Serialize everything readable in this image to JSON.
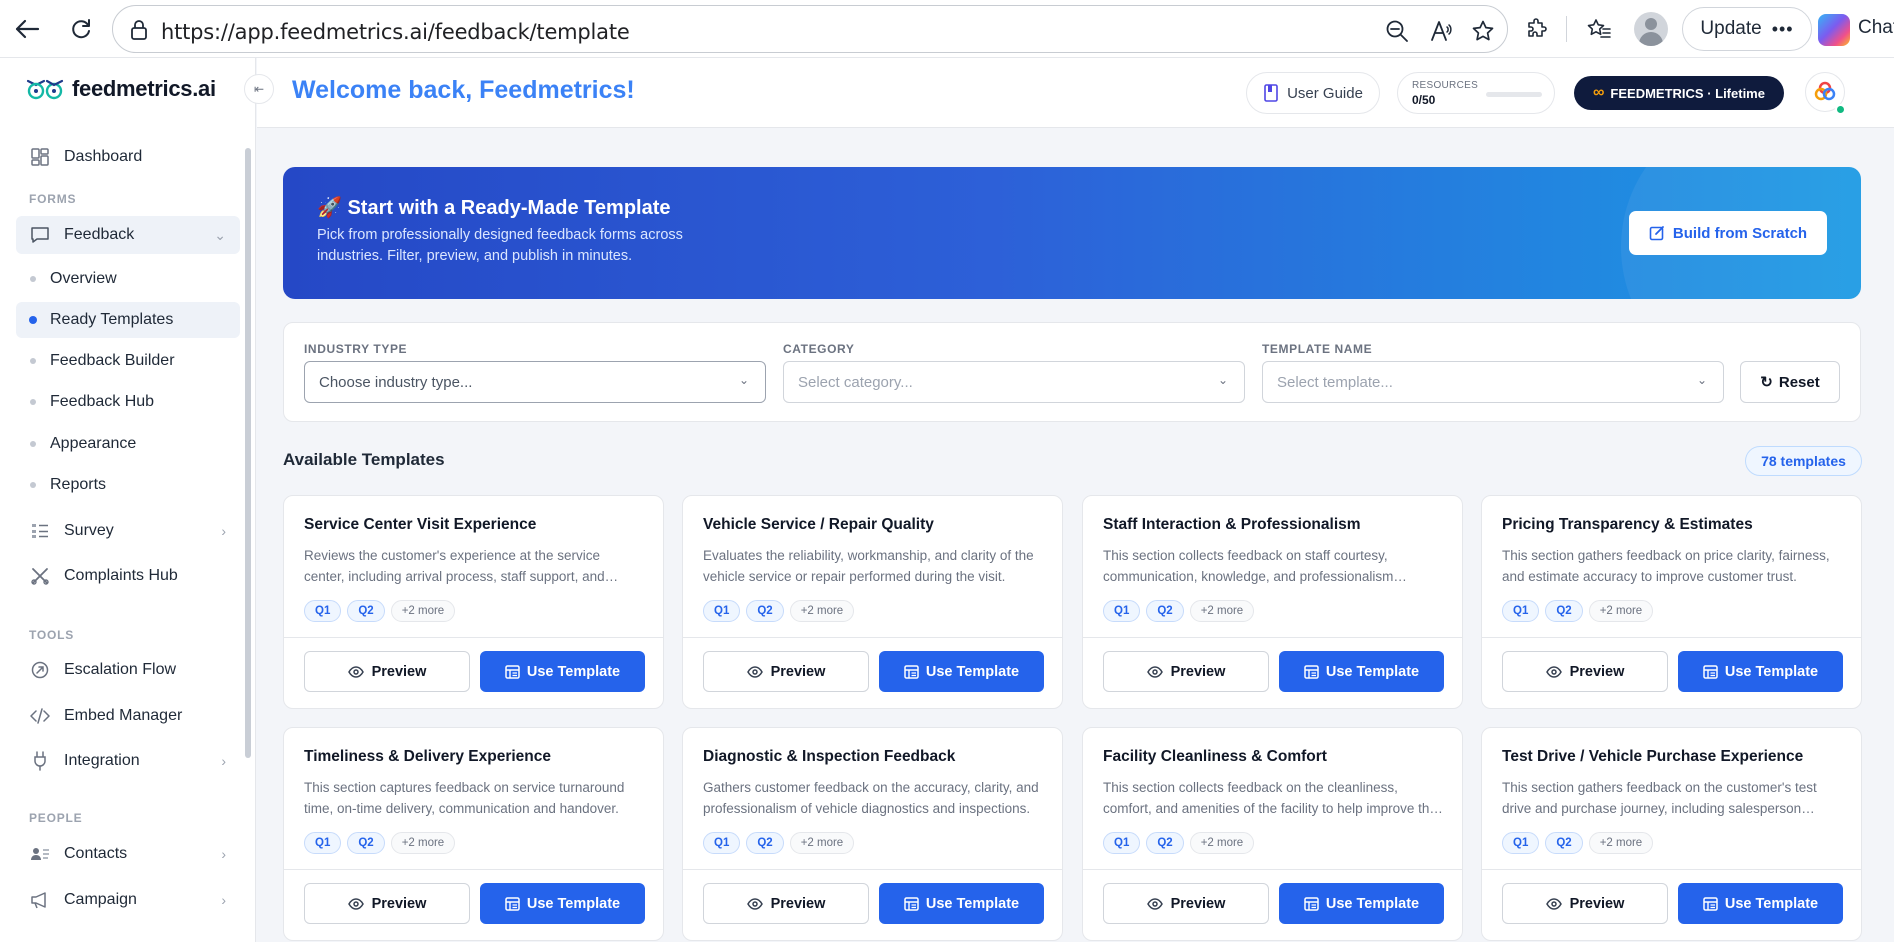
{
  "browser": {
    "url": "https://app.feedmetrics.ai/feedback/template",
    "update_label": "Update",
    "chat_label": "Chat"
  },
  "sidebar": {
    "logo_text": "feedmetrics.ai",
    "dashboard": "Dashboard",
    "forms_label": "FORMS",
    "feedback": "Feedback",
    "sub_items": [
      "Overview",
      "Ready Templates",
      "Feedback Builder",
      "Feedback Hub",
      "Appearance",
      "Reports"
    ],
    "survey": "Survey",
    "complaints": "Complaints Hub",
    "tools_label": "TOOLS",
    "escalation": "Escalation Flow",
    "embed": "Embed Manager",
    "integration": "Integration",
    "people_label": "PEOPLE",
    "contacts": "Contacts",
    "campaign": "Campaign"
  },
  "header": {
    "welcome": "Welcome back, Feedmetrics!",
    "user_guide": "User Guide",
    "resources_label": "RESOURCES",
    "resources_value": "0/50",
    "resources_fraction": 0,
    "plan": "FEEDMETRICS · Lifetime"
  },
  "hero": {
    "title": "🚀 Start with a Ready-Made Template",
    "description": "Pick from professionally designed feedback forms across industries. Filter, preview, and publish in minutes.",
    "build_label": "Build from Scratch"
  },
  "filters": {
    "industry_label": "INDUSTRY TYPE",
    "industry_placeholder": "Choose industry type...",
    "category_label": "CATEGORY",
    "category_placeholder": "Select category...",
    "template_label": "TEMPLATE NAME",
    "template_placeholder": "Select template...",
    "reset_label": "Reset"
  },
  "available": {
    "title": "Available Templates",
    "count": "78 templates"
  },
  "card_labels": {
    "preview": "Preview",
    "use": "Use Template"
  },
  "cards": [
    {
      "title": "Service Center Visit Experience",
      "desc": "Reviews the customer's experience at the service center, including arrival process, staff support, and overall visit satisfaction.",
      "tags": [
        "Q1",
        "Q2",
        "+2 more"
      ]
    },
    {
      "title": "Vehicle Service / Repair Quality",
      "desc": "Evaluates the reliability, workmanship, and clarity of the vehicle service or repair performed during the visit.",
      "tags": [
        "Q1",
        "Q2",
        "+2 more"
      ]
    },
    {
      "title": "Staff Interaction & Professionalism",
      "desc": "This section collects feedback on staff courtesy, communication, knowledge, and professionalism throughout the visit.",
      "tags": [
        "Q1",
        "Q2",
        "+2 more"
      ]
    },
    {
      "title": "Pricing Transparency & Estimates",
      "desc": "This section gathers feedback on price clarity, fairness, and estimate accuracy to improve customer trust.",
      "tags": [
        "Q1",
        "Q2",
        "+2 more"
      ]
    },
    {
      "title": "Timeliness & Delivery Experience",
      "desc": "This section captures feedback on service turnaround time, on-time delivery, communication and handover.",
      "tags": [
        "Q1",
        "Q2",
        "+2 more"
      ]
    },
    {
      "title": "Diagnostic & Inspection Feedback",
      "desc": "Gathers customer feedback on the accuracy, clarity, and professionalism of vehicle diagnostics and inspections.",
      "tags": [
        "Q1",
        "Q2",
        "+2 more"
      ]
    },
    {
      "title": "Facility Cleanliness & Comfort",
      "desc": "This section collects feedback on the cleanliness, comfort, and amenities of the facility to help improve the experience.",
      "tags": [
        "Q1",
        "Q2",
        "+2 more"
      ]
    },
    {
      "title": "Test Drive / Vehicle Purchase Experience",
      "desc": "This section gathers feedback on the customer's test drive and purchase journey, including salesperson support.",
      "tags": [
        "Q1",
        "Q2",
        "+2 more"
      ]
    }
  ]
}
